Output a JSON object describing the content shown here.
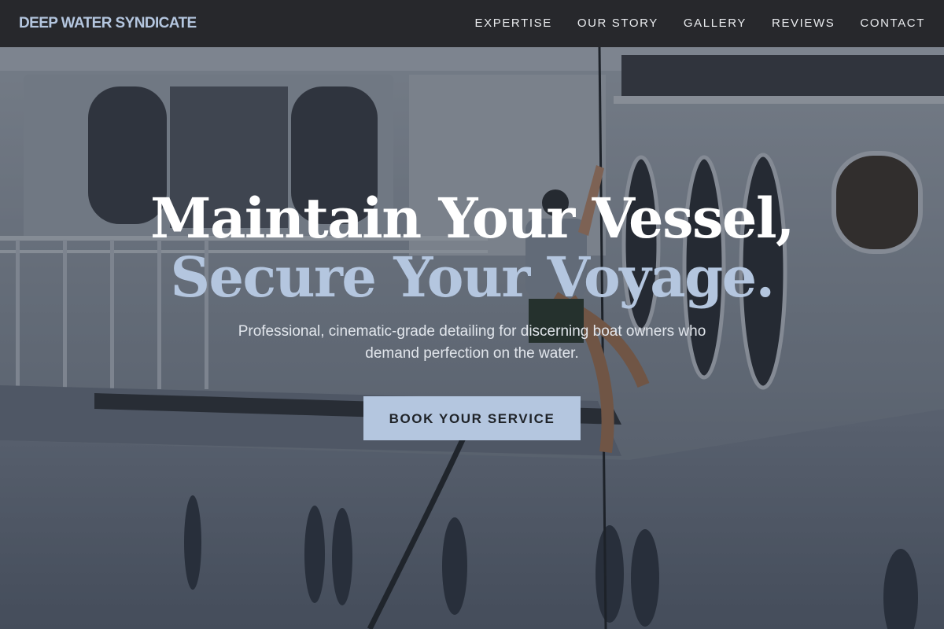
{
  "brand": {
    "name": "DEEP WATER SYNDICATE"
  },
  "nav": {
    "items": [
      {
        "label": "EXPERTISE"
      },
      {
        "label": "OUR STORY"
      },
      {
        "label": "GALLERY"
      },
      {
        "label": "REVIEWS"
      },
      {
        "label": "CONTACT"
      }
    ]
  },
  "hero": {
    "headline_line1": "Maintain Your Vessel,",
    "headline_line2": "Secure Your Voyage.",
    "subtitle": "Professional, cinematic-grade detailing for discerning boat owners who demand perfection on the water.",
    "cta_label": "BOOK YOUR SERVICE"
  },
  "colors": {
    "accent": "#b4c6df",
    "nav_background": "#26282b",
    "nav_text": "#e9ebee",
    "headline_primary": "#ffffff",
    "cta_text": "#1f2328"
  }
}
